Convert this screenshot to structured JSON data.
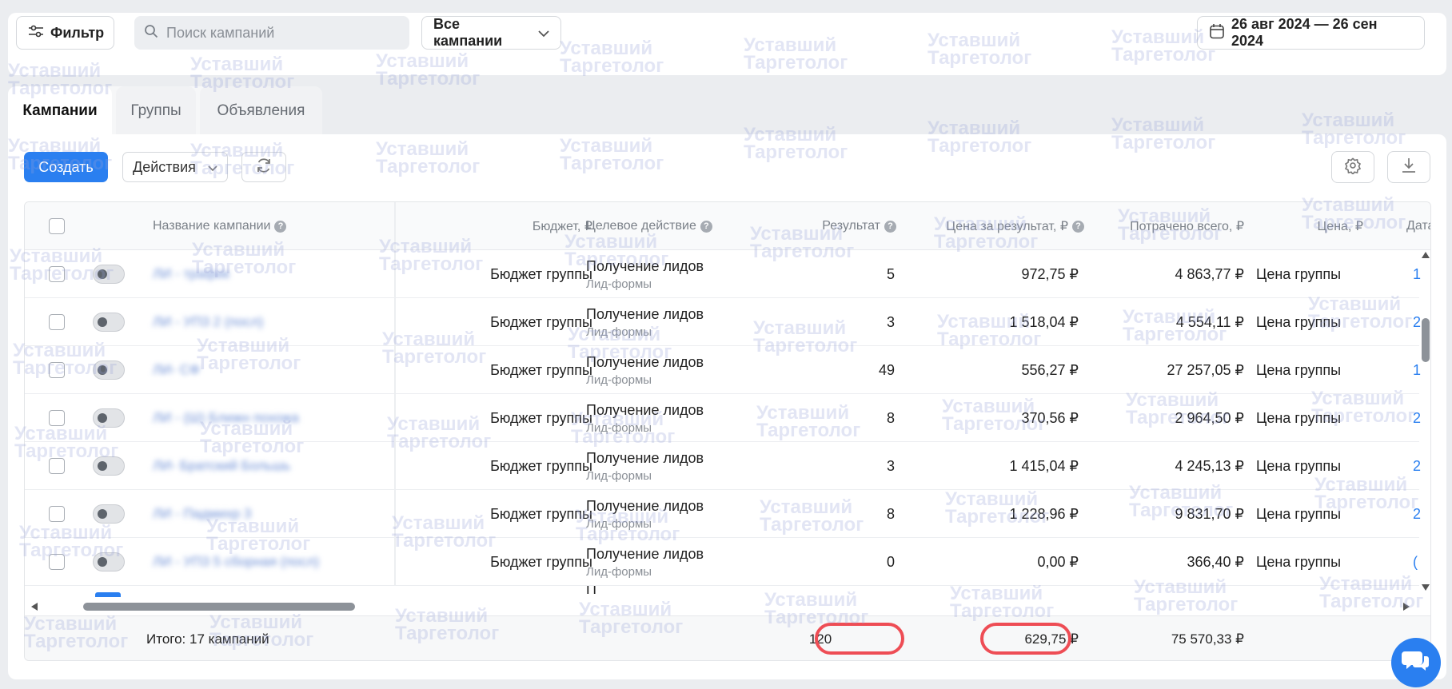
{
  "toolbar": {
    "filter_label": "Фильтр",
    "search_placeholder": "Поиск кампаний",
    "select_value": "Все кампании",
    "date_range": "26 авг 2024 — 26 сен 2024"
  },
  "tabs": [
    {
      "label": "Кампании",
      "active": true
    },
    {
      "label": "Группы",
      "active": false
    },
    {
      "label": "Объявления",
      "active": false
    }
  ],
  "actions": {
    "create_label": "Создать",
    "actions_label": "Действия"
  },
  "table": {
    "headers": {
      "name": "Название кампании",
      "budget": "Бюджет, ₽",
      "target": "Целевое действие",
      "result": "Результат",
      "cost_per_result": "Цена за результат, ₽",
      "spent": "Потрачено всего, ₽",
      "price": "Цена, ₽",
      "date": "Дата"
    },
    "rows": [
      {
        "name": "ЛИ - трафик",
        "budget": "Бюджет группы",
        "action": "Получение лидов",
        "action_sub": "Лид-формы",
        "result": "5",
        "cpr": "972,75 ₽",
        "spent": "4 863,77 ₽",
        "price": "Цена группы",
        "date": "1"
      },
      {
        "name": "ЛИ - УП3 2 (посл)",
        "budget": "Бюджет группы",
        "action": "Получение лидов",
        "action_sub": "Лид-формы",
        "result": "3",
        "cpr": "1 518,04 ₽",
        "spent": "4 554,11 ₽",
        "price": "Цена группы",
        "date": "2"
      },
      {
        "name": "ЛИ- СФ",
        "budget": "Бюджет группы",
        "action": "Получение лидов",
        "action_sub": "Лид-формы",
        "result": "49",
        "cpr": "556,27 ₽",
        "spent": "27 257,05 ₽",
        "price": "Цена группы",
        "date": "1"
      },
      {
        "name": "ЛИ - (Ш) Ближн похожа",
        "budget": "Бюджет группы",
        "action": "Получение лидов",
        "action_sub": "Лид-формы",
        "result": "8",
        "cpr": "370,56 ₽",
        "spent": "2 964,50 ₽",
        "price": "Цена группы",
        "date": "2"
      },
      {
        "name": "ЛИ- Братский Большь",
        "budget": "Бюджет группы",
        "action": "Получение лидов",
        "action_sub": "Лид-формы",
        "result": "3",
        "cpr": "1 415,04 ₽",
        "spent": "4 245,13 ₽",
        "price": "Цена группы",
        "date": "2"
      },
      {
        "name": "ЛИ - Падмихр 3",
        "budget": "Бюджет группы",
        "action": "Получение лидов",
        "action_sub": "Лид-формы",
        "result": "8",
        "cpr": "1 228,96 ₽",
        "spent": "9 831,70 ₽",
        "price": "Цена группы",
        "date": "2"
      },
      {
        "name": "ЛИ - УП3 5 сборная (посл)",
        "budget": "Бюджет группы",
        "action": "Получение лидов",
        "action_sub": "Лид-формы",
        "result": "0",
        "cpr": "0,00 ₽",
        "spent": "366,40 ₽",
        "price": "Цена группы",
        "date": "("
      }
    ],
    "partial_row_action": "П"
  },
  "totals": {
    "label": "Итого: 17 кампаний",
    "result": "120",
    "cpr": "629,75 ₽",
    "spent": "75 570,33 ₽"
  },
  "watermark": {
    "line1": "Уставший",
    "line2": "Таргетолог"
  },
  "colors": {
    "accent": "#2a7ff0",
    "highlight": "#ee4d55"
  }
}
